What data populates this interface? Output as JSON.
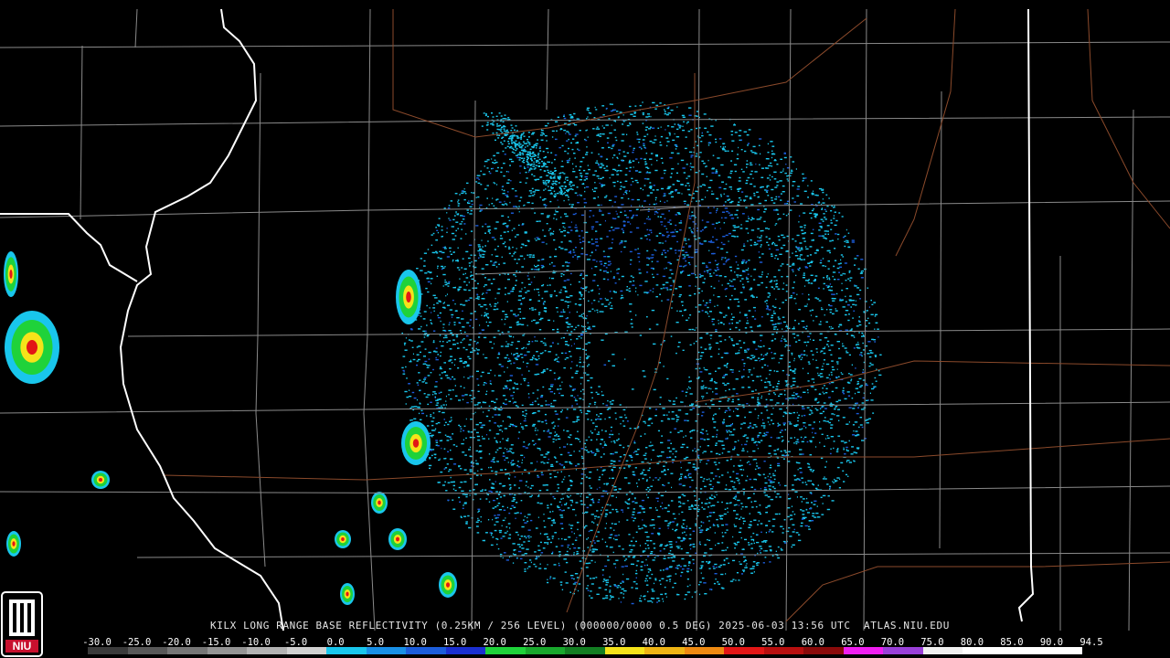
{
  "product": {
    "station": "KILX",
    "caption": "KILX LONG RANGE BASE REFLECTIVITY (0.25KM / 256 LEVEL) (000000/0000 0.5 DEG) 2025-06-03 13:56 UTC  ATLAS.NIU.EDU"
  },
  "logo": {
    "text": "NIU",
    "color": "#c8102e"
  },
  "colors": {
    "background": "#000000",
    "county_lines": "#8a8a8a",
    "state_lines": "#ffffff",
    "roads": "#8b4a2b",
    "light_echo": "#19c6ec",
    "medium_echo": "#1c5ddb",
    "green_echo": "#1fd23a",
    "yellow_echo": "#f5e31a",
    "red_echo": "#e21616"
  },
  "scale": {
    "labels": [
      "-30.0",
      "-25.0",
      "-20.0",
      "-15.0",
      "-10.0",
      "-5.0",
      "0.0",
      "5.0",
      "10.0",
      "15.0",
      "20.0",
      "25.0",
      "30.0",
      "35.0",
      "40.0",
      "45.0",
      "50.0",
      "55.0",
      "60.0",
      "65.0",
      "70.0",
      "75.0",
      "80.0",
      "85.0",
      "90.0",
      "94.5"
    ],
    "segment_colors": [
      "#3a3a3a",
      "#585858",
      "#767676",
      "#949494",
      "#b2b2b2",
      "#d0d0d0",
      "#19c6ec",
      "#1990e6",
      "#1c5ddb",
      "#1b2fd0",
      "#1fd23a",
      "#19a82d",
      "#137e22",
      "#f5e31a",
      "#eeb414",
      "#ee8a12",
      "#e21616",
      "#b80f0f",
      "#8a0a0a",
      "#f01ef0",
      "#9a40d8",
      "#f0f0f0",
      "#ffffff",
      "#ffffff",
      "#ffffff"
    ]
  }
}
